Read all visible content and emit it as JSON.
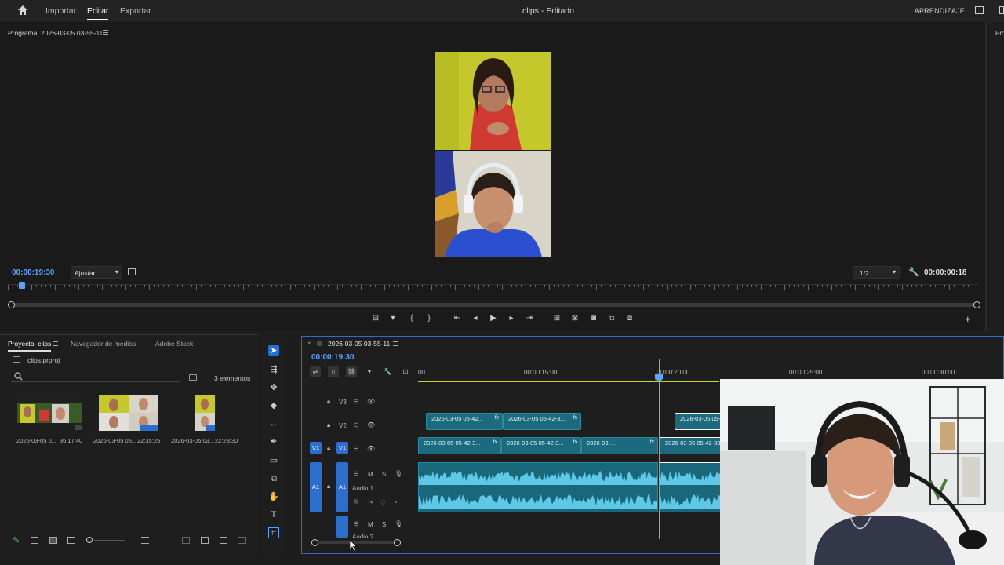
{
  "topbar": {
    "nav": [
      "Importar",
      "Editar",
      "Exportar"
    ],
    "title": "clips - Editado",
    "learn": "APRENDIZAJE"
  },
  "program": {
    "title": "Programa: 2026-03-05 03-55-11",
    "timecode": "00:00:19:30",
    "fit": "Ajustar",
    "resolution": "1/2",
    "duration": "00:00:00:18"
  },
  "right_panel": {
    "label": "Pro"
  },
  "project": {
    "tabs": [
      "Proyecto: clips",
      "Navegador de medios",
      "Adobe Stock"
    ],
    "file": "clips.prproj",
    "count": "3 elementos",
    "items": [
      {
        "name": "2026-03-05 0...",
        "duration": "36:17:40"
      },
      {
        "name": "2026-03-05 05...",
        "duration": "22:35:25"
      },
      {
        "name": "2026-03-05 03...",
        "duration": "22:23:30"
      }
    ]
  },
  "timeline": {
    "sequence": "2026-03-05 03-55-11",
    "timecode": "00:00:19:30",
    "ruler": [
      "00",
      "00:00:15:00",
      "00:00:20:00",
      "00:00:25:00",
      "00:00:30:00"
    ],
    "tracks": {
      "v3": "V3",
      "v2": "V2",
      "v1": "V1",
      "a1": "A1",
      "audio1": "Audio 1",
      "audio2": "Audio 2"
    },
    "clips_v2": [
      "2026-03-05 05-42...",
      "2026-03-05 05-42-3...",
      "2026-03-05 05-4"
    ],
    "clips_v1": [
      "2026-03-05 05-42-3...",
      "2026-03-05 05-42-3...",
      "2026-03-...",
      "2026-03-05 05-42-33..."
    ],
    "fx": "fx",
    "m": "M",
    "s": "S"
  }
}
